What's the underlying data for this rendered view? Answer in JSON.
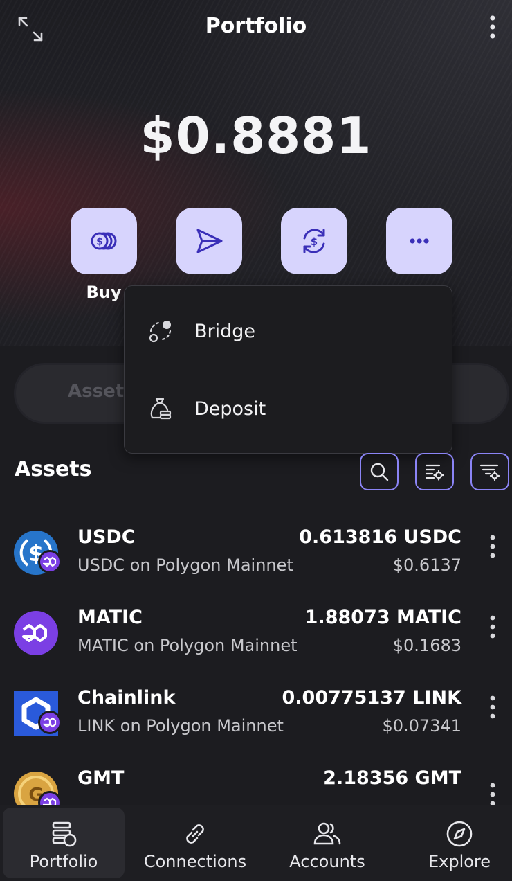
{
  "header": {
    "title": "Portfolio",
    "icons": {
      "expand": "expand-icon",
      "menu": "kebab-menu-icon"
    }
  },
  "balance": {
    "value": "$0.8881"
  },
  "actions": [
    {
      "id": "buy",
      "icon": "coins-icon",
      "label": "Buy"
    },
    {
      "id": "send",
      "icon": "send-icon",
      "label": ""
    },
    {
      "id": "swap",
      "icon": "swap-icon",
      "label": ""
    },
    {
      "id": "more",
      "icon": "more-icon",
      "label": ""
    }
  ],
  "tabs": {
    "visible_label": "Assets"
  },
  "dropdown": {
    "items": [
      {
        "label": "Bridge",
        "icon": "bridge-icon"
      },
      {
        "label": "Deposit",
        "icon": "deposit-bag-icon"
      }
    ]
  },
  "assets_section": {
    "heading": "Assets",
    "tools": [
      "search-icon",
      "list-settings-icon",
      "filter-settings-icon"
    ]
  },
  "assets": [
    {
      "name": "USDC",
      "network": "USDC on Polygon Mainnet",
      "amount": "0.613816 USDC",
      "usd": "$0.6137",
      "logo": "usdc-logo"
    },
    {
      "name": "MATIC",
      "network": "MATIC on Polygon Mainnet",
      "amount": "1.88073 MATIC",
      "usd": "$0.1683",
      "logo": "matic-logo"
    },
    {
      "name": "Chainlink",
      "network": "LINK on Polygon Mainnet",
      "amount": "0.00775137 LINK",
      "usd": "$0.07341",
      "logo": "chainlink-logo"
    },
    {
      "name": "GMT",
      "network": "",
      "amount": "2.18356 GMT",
      "usd": "",
      "logo": "gmt-logo"
    }
  ],
  "bottom_nav": [
    {
      "label": "Portfolio",
      "icon": "portfolio-icon",
      "active": true
    },
    {
      "label": "Connections",
      "icon": "link-icon",
      "active": false
    },
    {
      "label": "Accounts",
      "icon": "users-icon",
      "active": false
    },
    {
      "label": "Explore",
      "icon": "compass-icon",
      "active": false
    }
  ],
  "colors": {
    "accent": "#8b84f6",
    "action_bg": "#d7d4fd",
    "action_icon": "#3a2fb8",
    "background": "#1c1c20",
    "polygon": "#7b3fe4",
    "usdc": "#2775ca",
    "chainlink": "#2a5ada"
  }
}
